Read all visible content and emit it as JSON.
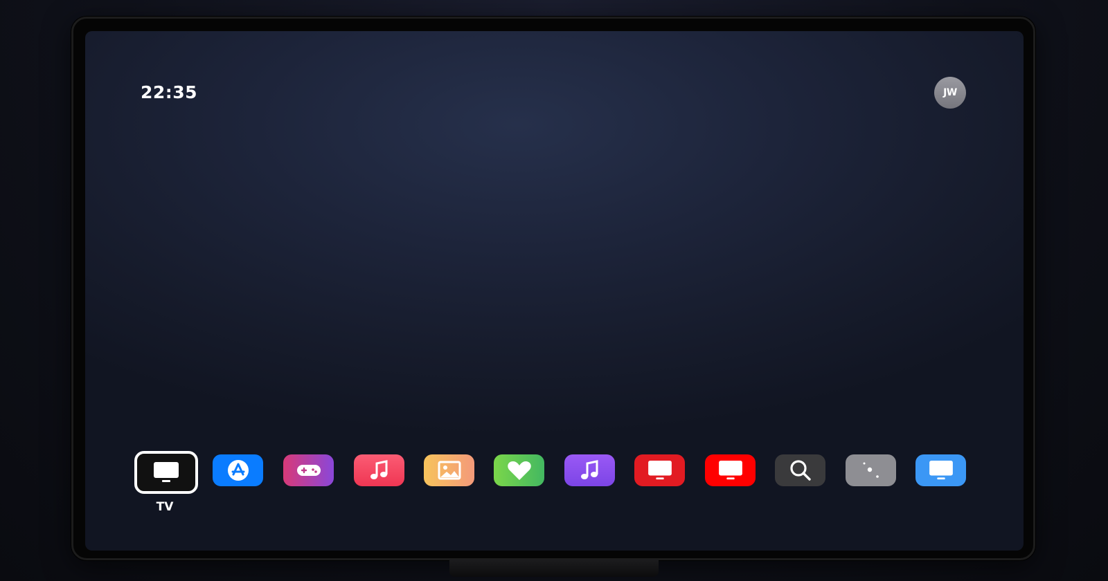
{
  "status_bar": {
    "clock": "22:35",
    "user_initials": "JW"
  },
  "dock": {
    "selected_label": "TV",
    "apps": [
      {
        "icon": "tv-icon",
        "color": "#111111",
        "selected": true
      },
      {
        "icon": "app-store-icon",
        "color": "#0a7cff"
      },
      {
        "icon": "game-controller-icon",
        "color": "#c03a8a"
      },
      {
        "icon": "music-note-icon",
        "color": "#f0435e"
      },
      {
        "icon": "photos-icon",
        "color": "#f5b25c"
      },
      {
        "icon": "heart-icon",
        "color": "#5cc94a"
      },
      {
        "icon": "music-note-icon",
        "color": "#8a4dee"
      },
      {
        "icon": "tv-icon",
        "color": "#e21b22"
      },
      {
        "icon": "tv-icon",
        "color": "#ff0000"
      },
      {
        "icon": "search-icon",
        "color": "#3a3a3c"
      },
      {
        "icon": "settings-dots-icon",
        "color": "#8e8e93"
      },
      {
        "icon": "tv-icon",
        "color": "#3b97f5"
      }
    ]
  }
}
